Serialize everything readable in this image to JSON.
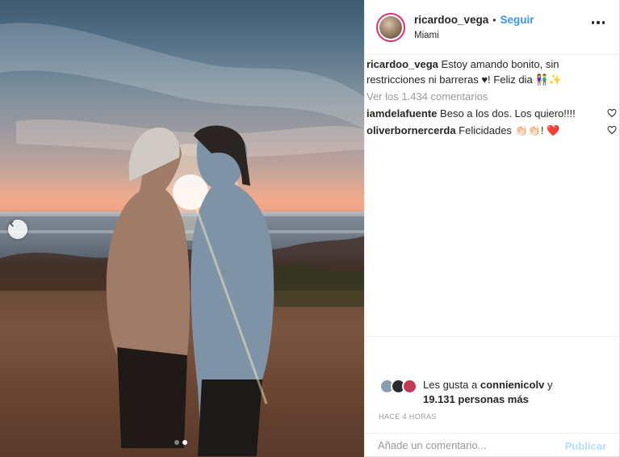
{
  "post": {
    "username": "ricardoo_vega",
    "follow_label": "Seguir",
    "location": "Miami",
    "caption_username": "ricardoo_vega",
    "caption_text": "Estoy amando bonito, sin restricciones ni barreras ♥! Feliz dia 👫✨",
    "view_all_comments": "Ver los 1.434 comentarios",
    "comments": [
      {
        "username": "iamdelafuente",
        "text": "Beso a los dos. Los quiero!!!!"
      },
      {
        "username": "oliverbornercerda",
        "text": "Felicidades 👏🏻👏🏻! ❤️"
      }
    ],
    "likes_prefix": "Les gusta a",
    "likes_user": "connienicolv",
    "likes_conjunction": "y",
    "likes_count": "19.131 personas más",
    "timestamp": "HACE 4 HORAS",
    "comment_placeholder": "Añade un comentario...",
    "publish_label": "Publicar",
    "carousel": {
      "total": 2,
      "active": 2
    }
  },
  "colors": {
    "accent_link": "#3897f0",
    "muted_text": "#999999",
    "publish_disabled": "#b2dffc",
    "heart_red": "#ed4956"
  },
  "icons": [
    "chevron-left-icon",
    "more-options-icon",
    "heart-outline-icon"
  ]
}
